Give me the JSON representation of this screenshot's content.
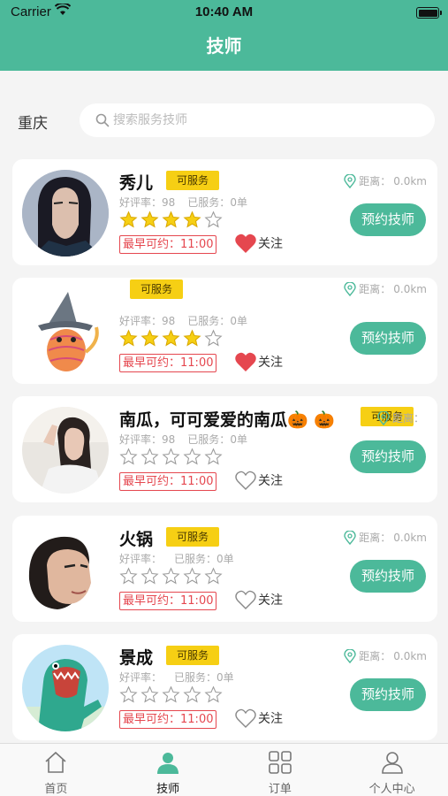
{
  "status_bar": {
    "carrier": "Carrier",
    "time": "10:40 AM"
  },
  "nav": {
    "title": "技师"
  },
  "search": {
    "city": "重庆",
    "placeholder": "搜索服务技师"
  },
  "labels": {
    "rating_prefix": "好评率：",
    "served_prefix": "已服务：",
    "distance_prefix": "距离：",
    "earliest_prefix": "最早可约：",
    "follow": "关注",
    "book": "预约技师"
  },
  "colors": {
    "brand": "#4cb99a",
    "badge": "#f6cf14",
    "alert": "#e5474f",
    "star": "#f6cf14",
    "heart": "#e5474f"
  },
  "therapists": [
    {
      "name": "秀儿",
      "badge": "可服务",
      "rating": "98",
      "served": "0单",
      "stars": 4,
      "earliest": "11:00",
      "distance": "0.0km",
      "followed": true
    },
    {
      "name": "",
      "badge": "可服务",
      "rating": "98",
      "served": "0单",
      "stars": 4,
      "earliest": "11:00",
      "distance": "0.0km",
      "followed": true
    },
    {
      "name": "南瓜，可可爱爱的南瓜🎃 🎃",
      "badge": "可服务",
      "rating": "98",
      "served": "0单",
      "stars": 0,
      "earliest": "11:00",
      "distance": "",
      "followed": false
    },
    {
      "name": "火锅",
      "badge": "可服务",
      "rating": "",
      "served": "0单",
      "stars": 0,
      "earliest": "11:00",
      "distance": "0.0km",
      "followed": false
    },
    {
      "name": "景成",
      "badge": "可服务",
      "rating": "",
      "served": "0单",
      "stars": 0,
      "earliest": "11:00",
      "distance": "0.0km",
      "followed": false
    }
  ],
  "tabs": [
    {
      "label": "首页",
      "icon": "home-icon",
      "active": false
    },
    {
      "label": "技师",
      "icon": "person-icon",
      "active": true
    },
    {
      "label": "订单",
      "icon": "grid-icon",
      "active": false
    },
    {
      "label": "个人中心",
      "icon": "user-icon",
      "active": false
    }
  ]
}
